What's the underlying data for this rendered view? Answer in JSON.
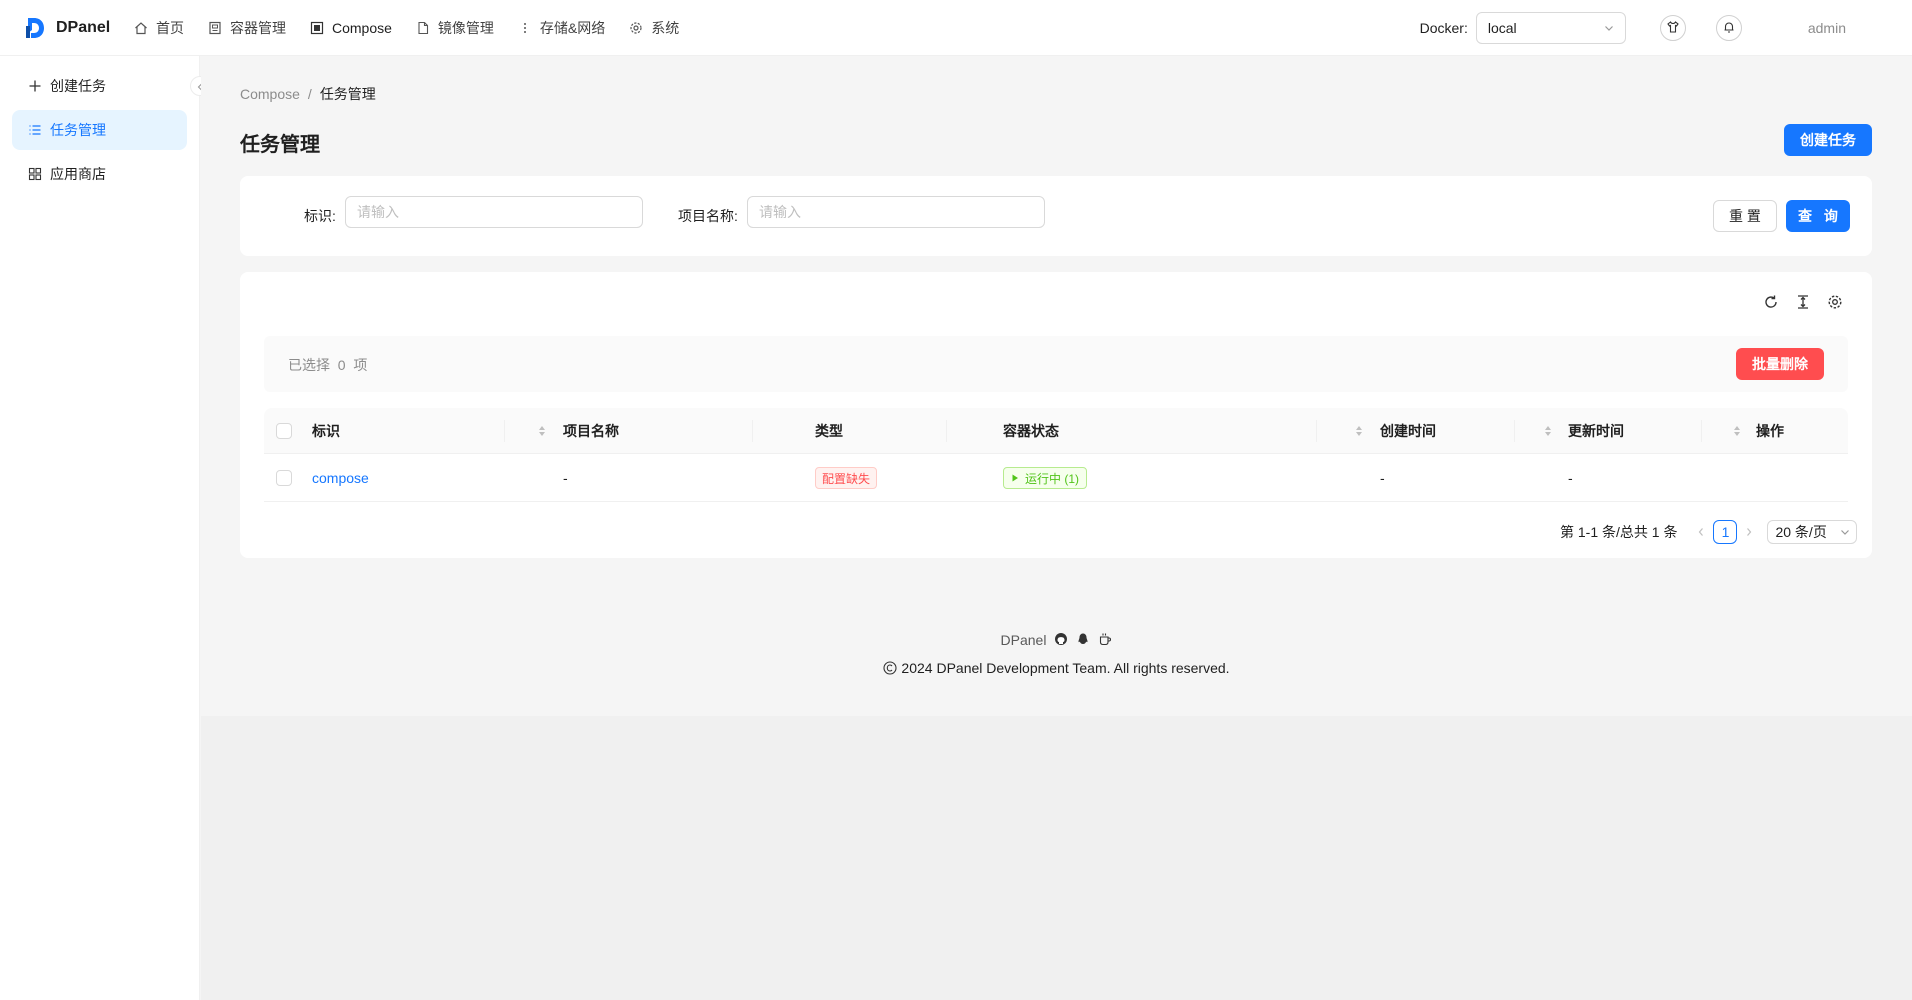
{
  "header": {
    "logo_text": "DPanel",
    "nav": [
      {
        "label": "首页",
        "icon": "home-icon"
      },
      {
        "label": "容器管理",
        "icon": "container-icon"
      },
      {
        "label": "Compose",
        "icon": "compose-icon"
      },
      {
        "label": "镜像管理",
        "icon": "file-icon"
      },
      {
        "label": "存储&网络",
        "icon": "more-vertical-icon"
      },
      {
        "label": "系统",
        "icon": "gear-icon"
      }
    ],
    "docker_label": "Docker:",
    "docker_value": "local",
    "user": "admin"
  },
  "sidebar": {
    "items": [
      {
        "label": "创建任务",
        "icon": "plus-icon"
      },
      {
        "label": "任务管理",
        "icon": "list-icon"
      },
      {
        "label": "应用商店",
        "icon": "appstore-icon"
      }
    ]
  },
  "breadcrumb": {
    "parent": "Compose",
    "separator": "/",
    "current": "任务管理"
  },
  "page": {
    "title": "任务管理",
    "create_label": "创建任务"
  },
  "search": {
    "fields": [
      {
        "label": "标识:",
        "placeholder": "请输入"
      },
      {
        "label": "项目名称:",
        "placeholder": "请输入"
      }
    ],
    "reset_label": "重 置",
    "query_label": "查 询"
  },
  "table": {
    "selected_prefix": "已选择",
    "selected_count": "0",
    "selected_suffix": "项",
    "batch_delete_label": "批量删除",
    "columns": [
      "标识",
      "项目名称",
      "类型",
      "容器状态",
      "创建时间",
      "更新时间",
      "操作"
    ],
    "rows": [
      {
        "name": "compose",
        "project": "-",
        "type": "配置缺失",
        "status": "运行中 (1)",
        "created": "-",
        "updated": "-",
        "action": ""
      }
    ]
  },
  "pagination": {
    "summary": "第 1-1 条/总共 1 条",
    "current_page": "1",
    "page_size": "20 条/页"
  },
  "footer": {
    "brand": "DPanel",
    "copyright": "2024 DPanel Development Team. All rights reserved."
  },
  "colors": {
    "primary": "#1677ff",
    "danger": "#ff4d4f",
    "success": "#52c41a"
  }
}
